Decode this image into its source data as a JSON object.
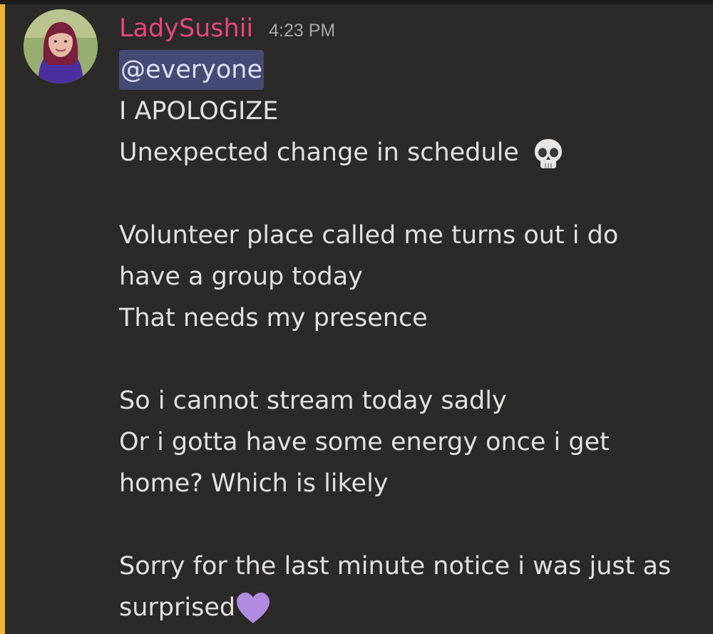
{
  "message": {
    "author": "LadySushii",
    "timestamp": "4:23 PM",
    "mention": "@everyone",
    "lines": [
      "I APOLOGIZE",
      "Unexpected change in schedule",
      "",
      "Volunteer place called me turns out i do",
      "have a group today",
      "That needs my presence",
      "",
      "So i cannot stream today sadly",
      "Or i gotta have some energy once i get",
      "home? Which is likely",
      "",
      "Sorry for the last minute notice i was just as",
      "surprised"
    ],
    "emojis": {
      "schedule_line": "skull-emoji",
      "last_line": "purple-heart-emoji"
    }
  },
  "colors": {
    "username": "#e8477a",
    "mention_bg": "#444a73",
    "highlight_bar": "#f0b232",
    "background": "#2b2a28"
  }
}
